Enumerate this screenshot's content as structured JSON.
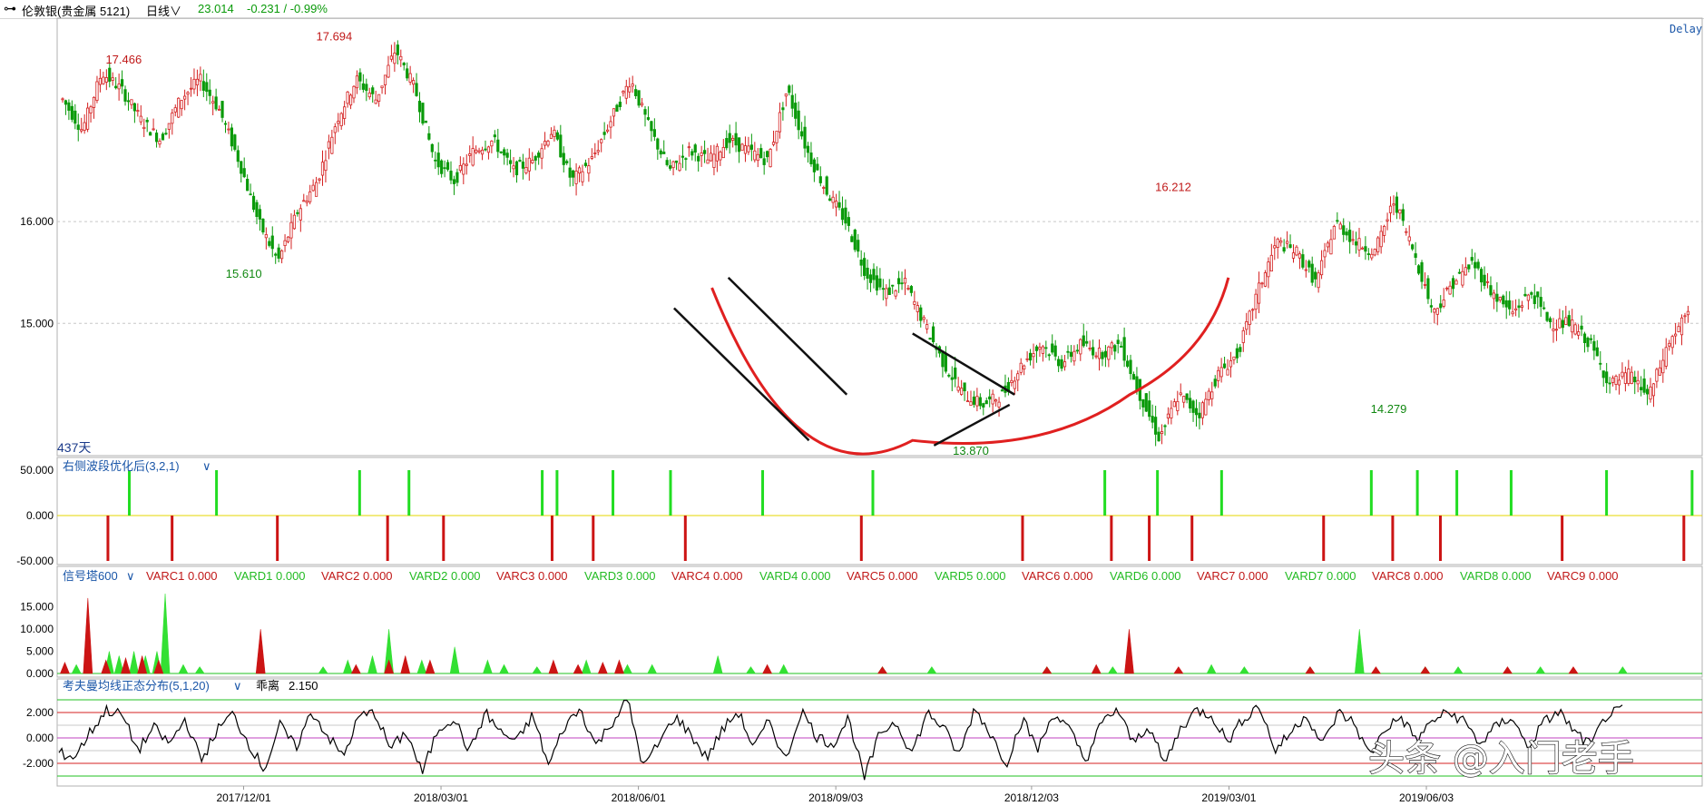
{
  "header": {
    "symbol_icon": "link-icon",
    "instrument": "伦敦银(贵金属 5121)",
    "period": "日线",
    "price": "23.014",
    "change": "-0.231 / -0.99%"
  },
  "delay_label": "Delay",
  "day_count_label": "437天",
  "colors": {
    "up": "#d42020",
    "down": "#0a9a0a",
    "arc": "#e02020",
    "grid": "#c8c8c8",
    "zero_line": "#e6d700",
    "panel_title": "#1a56a8",
    "green_bar": "#22dd22",
    "red_bar": "#cc1414"
  },
  "chart_data": [
    {
      "type": "candlestick",
      "name": "price",
      "y_ticks": [
        "16.000",
        "15.000"
      ],
      "y_tick_values": [
        16.0,
        15.0
      ],
      "ylim": [
        13.7,
        18.0
      ],
      "x_ticks": [
        "2017/12/01",
        "2018/03/01",
        "2018/06/01",
        "2018/09/03",
        "2018/12/03",
        "2019/03/01",
        "2019/06/03"
      ],
      "annotations": [
        "17.466",
        "17.694",
        "15.610",
        "16.212",
        "13.870",
        "14.279"
      ],
      "annotation_values": [
        17.466,
        17.694,
        15.61,
        16.212,
        13.87,
        14.279
      ],
      "trend_path": [
        17.2,
        16.9,
        17.466,
        17.3,
        17.0,
        16.8,
        17.2,
        17.4,
        17.1,
        16.6,
        16.0,
        15.61,
        16.1,
        16.4,
        17.0,
        17.4,
        17.2,
        17.694,
        17.3,
        16.6,
        16.4,
        16.7,
        16.8,
        16.5,
        16.6,
        16.9,
        16.4,
        16.6,
        17.0,
        17.4,
        16.9,
        16.5,
        16.7,
        16.6,
        16.8,
        16.7,
        16.6,
        17.3,
        16.7,
        16.3,
        16.0,
        15.5,
        15.3,
        15.4,
        15.0,
        14.6,
        14.3,
        14.2,
        14.3,
        14.6,
        14.8,
        14.6,
        14.8,
        14.7,
        14.8,
        14.3,
        13.87,
        14.3,
        14.1,
        14.5,
        14.7,
        15.3,
        15.8,
        15.7,
        15.4,
        16.0,
        15.8,
        15.7,
        16.212,
        15.7,
        15.1,
        15.4,
        15.6,
        15.3,
        15.1,
        15.3,
        15.0,
        15.0,
        14.8,
        14.4,
        14.5,
        14.279,
        14.8,
        15.1
      ]
    },
    {
      "type": "bar",
      "name": "右侧波段优化后(3,2,1)",
      "title": "右侧波段优化后(3,2,1)",
      "y_ticks": [
        "50.000",
        "0.000",
        "-50.000"
      ],
      "ylim": [
        -50,
        50
      ],
      "positive_positions": [
        0.032,
        0.085,
        0.172,
        0.202,
        0.283,
        0.292,
        0.326,
        0.361,
        0.417,
        0.484,
        0.625,
        0.657,
        0.696,
        0.787,
        0.815,
        0.839,
        0.872,
        0.93,
        0.982
      ],
      "negative_positions": [
        0.019,
        0.058,
        0.122,
        0.189,
        0.223,
        0.289,
        0.314,
        0.37,
        0.477,
        0.575,
        0.629,
        0.652,
        0.678,
        0.758,
        0.8,
        0.829,
        0.903,
        0.977,
        0.993
      ]
    },
    {
      "type": "area",
      "name": "信号塔600",
      "title": "信号塔600",
      "series_labels": [
        "VARC1 0.000",
        "VARD1 0.000",
        "VARC2 0.000",
        "VARD2 0.000",
        "VARC3 0.000",
        "VARD3 0.000",
        "VARC4 0.000",
        "VARD4 0.000",
        "VARC5 0.000",
        "VARD5 0.000",
        "VARC6 0.000",
        "VARD6 0.000",
        "VARC7 0.000",
        "VARD7 0.000",
        "VARC8 0.000",
        "VARD8 0.000",
        "VARC9 0.000"
      ],
      "y_ticks": [
        "15.000",
        "10.000",
        "5.000",
        "0.000"
      ],
      "ylim": [
        0,
        18
      ],
      "red_spikes": [
        [
          0.003,
          2.5
        ],
        [
          0.017,
          17
        ],
        [
          0.028,
          3
        ],
        [
          0.04,
          3.5
        ],
        [
          0.05,
          4
        ],
        [
          0.06,
          3
        ],
        [
          0.122,
          10
        ],
        [
          0.18,
          2
        ],
        [
          0.2,
          3
        ],
        [
          0.21,
          4
        ],
        [
          0.225,
          3
        ],
        [
          0.3,
          3
        ],
        [
          0.315,
          2
        ],
        [
          0.33,
          2.5
        ],
        [
          0.34,
          3
        ],
        [
          0.43,
          2
        ],
        [
          0.5,
          1.5
        ],
        [
          0.6,
          1.5
        ],
        [
          0.63,
          2
        ],
        [
          0.65,
          10
        ],
        [
          0.68,
          1.5
        ],
        [
          0.76,
          1.5
        ],
        [
          0.8,
          1.5
        ],
        [
          0.83,
          1.5
        ],
        [
          0.88,
          1.5
        ],
        [
          0.92,
          1.5
        ]
      ],
      "green_spikes": [
        [
          0.01,
          2
        ],
        [
          0.03,
          5
        ],
        [
          0.036,
          4
        ],
        [
          0.045,
          5
        ],
        [
          0.052,
          4
        ],
        [
          0.059,
          5
        ],
        [
          0.064,
          18
        ],
        [
          0.075,
          2
        ],
        [
          0.085,
          1.5
        ],
        [
          0.16,
          1.5
        ],
        [
          0.175,
          3
        ],
        [
          0.19,
          4
        ],
        [
          0.2,
          10
        ],
        [
          0.22,
          3
        ],
        [
          0.24,
          6
        ],
        [
          0.26,
          3
        ],
        [
          0.27,
          2
        ],
        [
          0.29,
          1.5
        ],
        [
          0.32,
          3
        ],
        [
          0.345,
          2
        ],
        [
          0.36,
          2
        ],
        [
          0.4,
          4
        ],
        [
          0.42,
          1.5
        ],
        [
          0.44,
          2
        ],
        [
          0.5,
          1.5
        ],
        [
          0.53,
          1.5
        ],
        [
          0.6,
          1.5
        ],
        [
          0.64,
          1.5
        ],
        [
          0.7,
          2
        ],
        [
          0.72,
          1.5
        ],
        [
          0.76,
          1.5
        ],
        [
          0.79,
          10
        ],
        [
          0.83,
          1.5
        ],
        [
          0.85,
          1.5
        ],
        [
          0.9,
          1.5
        ],
        [
          0.95,
          1.5
        ]
      ]
    },
    {
      "type": "line",
      "name": "考夫曼均线正态分布(5,1,20)",
      "title": "考夫曼均线正态分布(5,1,20)",
      "readout_label": "乖离",
      "readout_value": "2.150",
      "y_ticks": [
        "2.000",
        "0.000",
        "-2.000"
      ],
      "ylim": [
        -3.5,
        3.5
      ],
      "reference_lines": [
        {
          "value": 3.0,
          "color": "#20c020"
        },
        {
          "value": 2.0,
          "color": "#d42020"
        },
        {
          "value": 1.0,
          "color": "#c8c8c8"
        },
        {
          "value": 0.0,
          "color": "#c040c0"
        },
        {
          "value": -1.0,
          "color": "#c8c8c8"
        },
        {
          "value": -2.0,
          "color": "#d42020"
        },
        {
          "value": -3.0,
          "color": "#20c020"
        }
      ],
      "values": [
        -1.2,
        -1.5,
        0.5,
        2.2,
        1.8,
        -1.0,
        0.8,
        -0.5,
        1.5,
        -1.8,
        0.6,
        1.9,
        -0.4,
        -2.5,
        1.0,
        -0.8,
        2.1,
        0.2,
        -1.5,
        1.7,
        2.0,
        -0.9,
        0.5,
        -2.8,
        0.7,
        1.6,
        -1.1,
        2.0,
        0.4,
        -0.3,
        1.8,
        -2.2,
        0.9,
        2.3,
        -0.6,
        1.2,
        3.0,
        -2.3,
        -0.4,
        1.7,
        0.3,
        -1.6,
        0.6,
        2.1,
        -0.8,
        1.4,
        -1.9,
        2.2,
        0.1,
        -0.5,
        1.6,
        -3.2,
        0.4,
        1.3,
        -1.2,
        2.0,
        0.8,
        -1.4,
        2.4,
        0.3,
        -2.0,
        1.5,
        -0.9,
        2.0,
        0.6,
        -1.8,
        1.1,
        2.3,
        -0.4,
        1.0,
        -2.1,
        0.7,
        2.2,
        1.8,
        -0.3,
        1.5,
        2.6,
        -1.0,
        0.4,
        1.9,
        -0.6,
        2.0,
        1.2,
        -1.4,
        0.8,
        1.6,
        -0.2,
        1.4,
        2.0,
        1.3,
        -0.5,
        0.9,
        1.7,
        -0.8,
        1.2,
        2.1,
        0.4,
        -0.6,
        1.8,
        2.15
      ]
    }
  ],
  "watermark": "头条 @入门老手"
}
